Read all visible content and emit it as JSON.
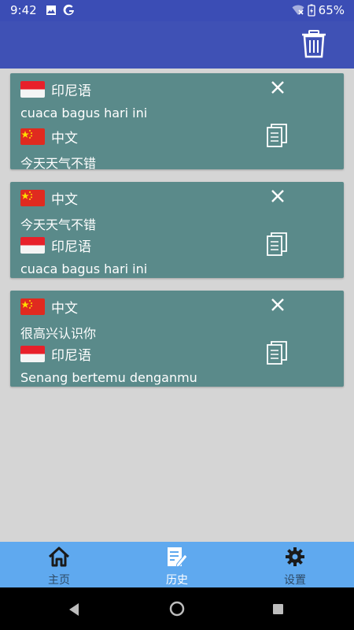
{
  "status_bar": {
    "time": "9:42",
    "battery": "65%"
  },
  "cards": [
    {
      "source_lang": "印尼语",
      "source_text": "cuaca bagus hari ini",
      "target_lang": "中文",
      "target_text": "今天天气不错"
    },
    {
      "source_lang": "中文",
      "source_text": "今天天气不错",
      "target_lang": "印尼语",
      "target_text": "cuaca bagus hari ini"
    },
    {
      "source_lang": "中文",
      "source_text": "很高兴认识你",
      "target_lang": "印尼语",
      "target_text": "Senang bertemu denganmu"
    }
  ],
  "nav": {
    "home": "主页",
    "history": "历史",
    "settings": "设置"
  },
  "colors": {
    "app_bar": "#3f51b5",
    "card": "#5a8a8a",
    "bottom_nav": "#5fa9ef",
    "active": "#ffffff",
    "inactive": "#2e4a66"
  }
}
